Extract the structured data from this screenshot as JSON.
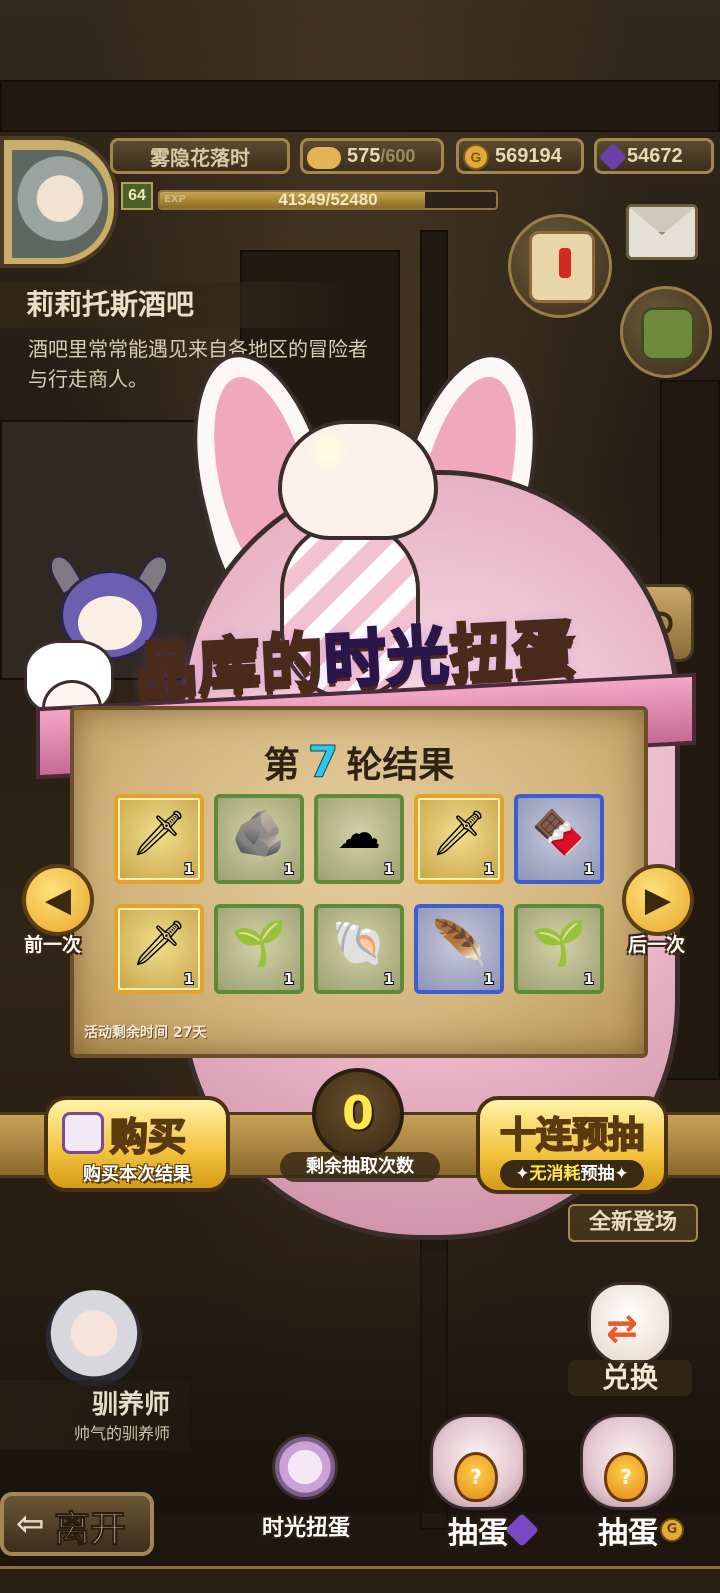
{
  "player": {
    "name": "雾隐花落时",
    "level": "64",
    "exp_label": "EXP",
    "exp_value": "41349/52480",
    "exp_fraction": 0.788
  },
  "currencies": {
    "stamina": "575",
    "stamina_max": "/600",
    "gold": "569194",
    "gems": "54672",
    "gold_icon_glyph": "G"
  },
  "location": {
    "name": "莉莉托斯酒吧",
    "description": "酒吧里常常能遇见来自各地区的冒险者与行走商人。"
  },
  "gacha": {
    "title_part1": "品库的",
    "title_accent": "时光",
    "title_part2": "扭蛋",
    "round_prefix": "第",
    "round_number": "7",
    "round_suffix": "轮结果",
    "event_time_remaining": "活动剩余时间  27天",
    "items": [
      {
        "icon": "sword-bundle-icon",
        "glyph": "🗡",
        "count": "1",
        "rarity": "gold"
      },
      {
        "icon": "ore-pile-icon",
        "glyph": "🪨",
        "count": "1",
        "rarity": "green"
      },
      {
        "icon": "cloud-orb-icon",
        "glyph": "☁",
        "count": "1",
        "rarity": "green"
      },
      {
        "icon": "dagger-icon",
        "glyph": "🗡",
        "count": "1",
        "rarity": "gold"
      },
      {
        "icon": "chocolate-blob-icon",
        "glyph": "🍫",
        "count": "1",
        "rarity": "blue"
      },
      {
        "icon": "sword-bundle-icon",
        "glyph": "🗡",
        "count": "1",
        "rarity": "gold"
      },
      {
        "icon": "blue-seed-icon",
        "glyph": "🌱",
        "count": "1",
        "rarity": "green"
      },
      {
        "icon": "fur-shell-icon",
        "glyph": "🐚",
        "count": "1",
        "rarity": "green"
      },
      {
        "icon": "red-feather-icon",
        "glyph": "🪶",
        "count": "1",
        "rarity": "blue"
      },
      {
        "icon": "green-seed-icon",
        "glyph": "🌱",
        "count": "1",
        "rarity": "green"
      }
    ],
    "prev_label": "前一次",
    "next_label": "后一次",
    "prev_glyph": "◀",
    "next_glyph": "▶",
    "buy_title": "购买",
    "buy_subtitle": "购买本次结果",
    "remaining_draws": "0",
    "remaining_draws_label": "剩余抽取次数",
    "ten_pull_title": "十连预抽",
    "ten_pull_sub_highlight": "无消耗",
    "ten_pull_sub_rest": "预抽",
    "sparkle_left": "✦",
    "sparkle_right": "✦"
  },
  "side": {
    "new_arrival": "全新登场",
    "exchange_label": "兑换",
    "return_glyph": "⮌",
    "exchange_glyph": "⇄"
  },
  "trainer": {
    "name": "驯养师",
    "title": "帅气的驯养师"
  },
  "bottom": {
    "leave_label": "离开",
    "leave_glyph": "⇦",
    "tab_time_label": "时光扭蛋",
    "tab_draw_label": "抽蛋",
    "tab_draw_label_2": "抽蛋",
    "egg_glyph": "?"
  }
}
